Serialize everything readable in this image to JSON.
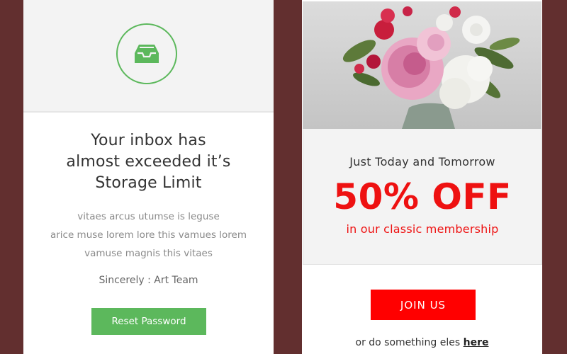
{
  "left_card": {
    "icon": "inbox-tray-icon",
    "headline": [
      "Your inbox has",
      "almost exceeded it’s",
      "Storage Limit"
    ],
    "body_lines": [
      "vitaes arcus utumse is leguse",
      "arice muse lorem lore this vamues lorem",
      "vamuse magnis this vitaes"
    ],
    "signoff": "Sincerely : Art Team",
    "button_label": "Reset Password"
  },
  "right_card": {
    "hero_image": "flower-bouquet-photo",
    "subtitle": "Just Today and Tomorrow",
    "offer": "50% OFF",
    "offer_note": "in our classic membership",
    "button_label": "JOIN US",
    "alt_text": "or do something eles",
    "alt_link": "here"
  },
  "colors": {
    "background": "#622f2f",
    "green_accent": "#5cb85c",
    "red_accent": "#ff0000",
    "offer_red": "#ee1111"
  }
}
